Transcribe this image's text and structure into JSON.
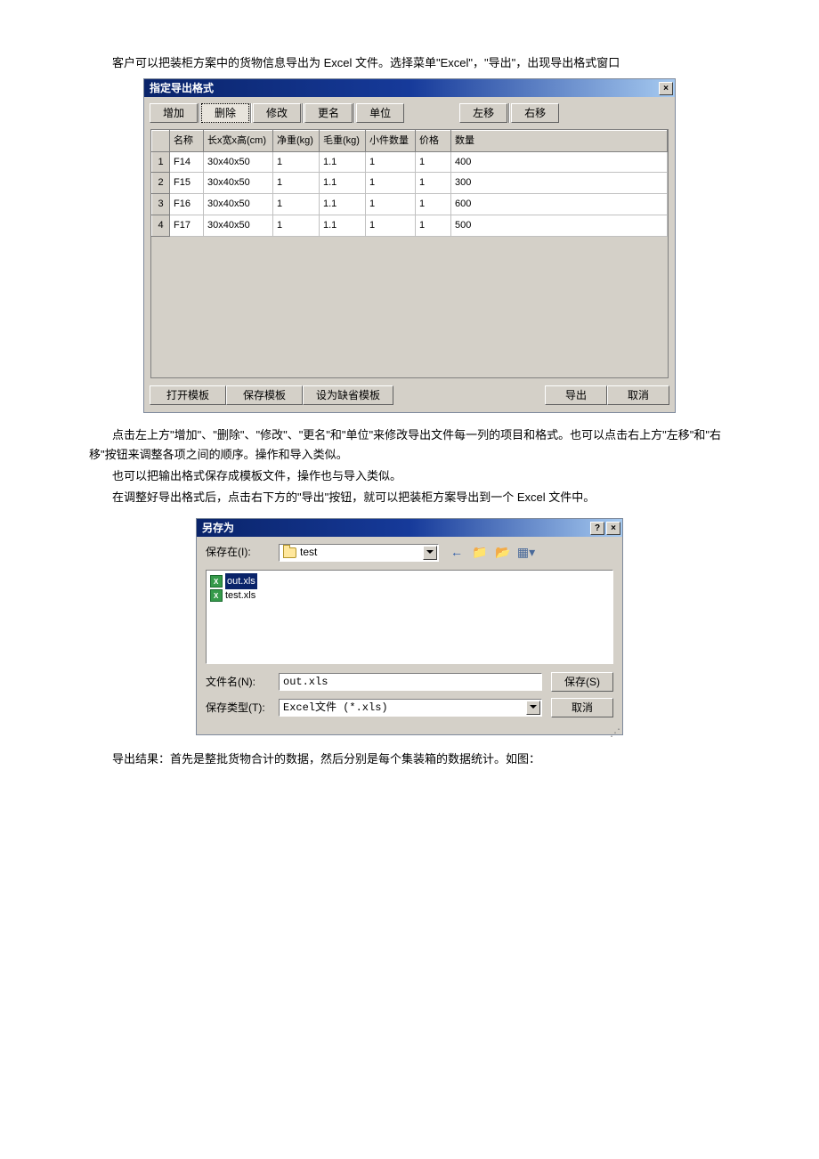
{
  "intro": "客户可以把装柜方案中的货物信息导出为 Excel 文件。选择菜单\"Excel\"，\"导出\"，出现导出格式窗口",
  "win1": {
    "title": "指定导出格式",
    "toolbar": {
      "add": "增加",
      "delete": "删除",
      "modify": "修改",
      "rename": "更名",
      "unit": "单位",
      "moveleft": "左移",
      "moveright": "右移"
    },
    "headers": {
      "n": "",
      "name": "名称",
      "dim": "长x宽x高(cm)",
      "net": "净重(kg)",
      "gross": "毛重(kg)",
      "pcs": "小件数量",
      "price": "价格",
      "qty": "数量"
    },
    "rows": [
      {
        "n": "1",
        "name": "F14",
        "dim": "30x40x50",
        "net": "1",
        "gross": "1.1",
        "pcs": "1",
        "price": "1",
        "qty": "400"
      },
      {
        "n": "2",
        "name": "F15",
        "dim": "30x40x50",
        "net": "1",
        "gross": "1.1",
        "pcs": "1",
        "price": "1",
        "qty": "300"
      },
      {
        "n": "3",
        "name": "F16",
        "dim": "30x40x50",
        "net": "1",
        "gross": "1.1",
        "pcs": "1",
        "price": "1",
        "qty": "600"
      },
      {
        "n": "4",
        "name": "F17",
        "dim": "30x40x50",
        "net": "1",
        "gross": "1.1",
        "pcs": "1",
        "price": "1",
        "qty": "500"
      }
    ],
    "footer": {
      "open": "打开模板",
      "save": "保存模板",
      "default": "设为缺省模板",
      "export": "导出",
      "cancel": "取消"
    }
  },
  "body": {
    "p1": "点击左上方\"增加\"、\"删除\"、\"修改\"、\"更名\"和\"单位\"来修改导出文件每一列的项目和格式。也可以点击右上方\"左移\"和\"右移\"按钮来调整各项之间的顺序。操作和导入类似。",
    "p2": "也可以把输出格式保存成模板文件，操作也与导入类似。",
    "p3": "在调整好导出格式后，点击右下方的\"导出\"按钮，就可以把装柜方案导出到一个 Excel 文件中。"
  },
  "win2": {
    "title": "另存为",
    "savein_lbl": "保存在(I):",
    "savein_val": "test",
    "files": [
      {
        "name": "out.xls",
        "sel": true
      },
      {
        "name": "test.xls",
        "sel": false
      }
    ],
    "filename_lbl": "文件名(N):",
    "filename_val": "out.xls",
    "filetype_lbl": "保存类型(T):",
    "filetype_val": "Excel文件 (*.xls)",
    "save_btn": "保存(S)",
    "cancel_btn": "取消"
  },
  "result": "导出结果：首先是整批货物合计的数据，然后分别是每个集装箱的数据统计。如图："
}
